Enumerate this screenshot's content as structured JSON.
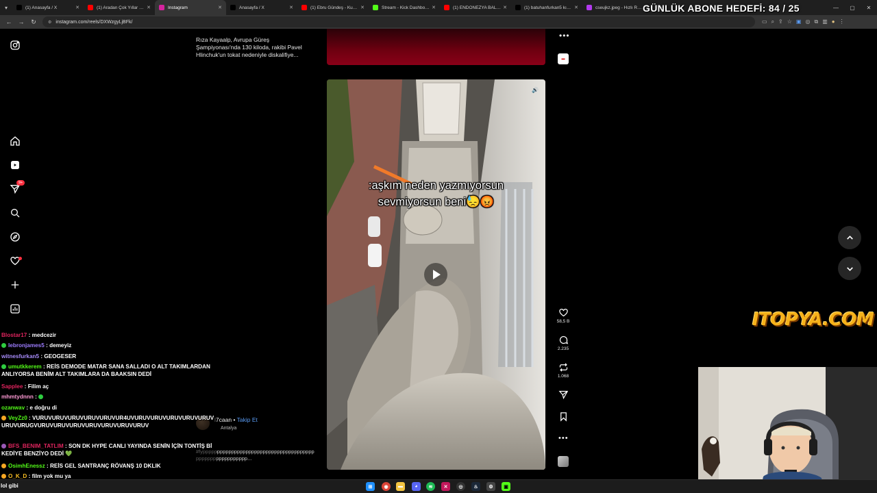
{
  "browser": {
    "tabs": [
      {
        "title": "(1) Anasayfa / X",
        "icon": "x-logo-icon",
        "color": "#000000"
      },
      {
        "title": "(1) Aradan Çok Yıllar Geçti",
        "icon": "youtube-icon",
        "color": "#ff0000"
      },
      {
        "title": "Instagram",
        "icon": "instagram-icon",
        "color": "#d6249f"
      },
      {
        "title": "Anasayfa / X",
        "icon": "x-logo-icon",
        "color": "#000000"
      },
      {
        "title": "(1) Ebru Gündeş - Kurşun",
        "icon": "youtube-icon",
        "color": "#ff0000"
      },
      {
        "title": "Stream - Kick Dashboard",
        "icon": "kick-icon",
        "color": "#53fc18"
      },
      {
        "title": "(1) ENDONEZYA BALI'DA",
        "icon": "youtube-icon",
        "color": "#ff0000"
      },
      {
        "title": "(1) batuhanfurkan5 kırıyor",
        "icon": "x-logo-icon",
        "color": "#000000"
      },
      {
        "title": "cseujkz.jpeg - Hızlı Resim",
        "icon": "image-icon",
        "color": "#b23aee"
      }
    ],
    "new_tab": "+",
    "url": "instagram.com/reels/DXWzgyLjBFk/"
  },
  "stream_goal": "GÜNLÜK ABONE HEDEFİ: 84 / 25",
  "instagram": {
    "sidebar_icons": [
      "instagram-logo-icon",
      "home-icon",
      "reels-icon",
      "messages-icon",
      "search-icon",
      "explore-icon",
      "notifications-icon",
      "create-icon",
      "dashboard-icon"
    ],
    "messages_badge": "9+",
    "previous_reel_caption": "Rıza Kayaalp, Avrupa Güreş Şampiyonası'nda 130 kiloda, rakibi Pavel Hlinchuk'un tokat nedeniyle diskalifiye...",
    "reel": {
      "overlay_line1": ":aşkım neden yazmıyorsun",
      "overlay_line2": "sevmiyorsun beni😓😡",
      "likes": "58,5 B",
      "comments": "2.235",
      "reposts": "1.068",
      "author": "l7caan",
      "follow": "Takip Et",
      "location": "Antalya",
      "caption": "#fyppppppppppppppppppppppppppppppppppppppppppppppppppppppppp..."
    }
  },
  "brand_overlay": "ITOPYA.COM",
  "chat": [
    {
      "user": "Blostar17",
      "msg": "medcezir",
      "color": "#e0245e"
    },
    {
      "user": "lebronjames5",
      "msg": "demeyiz",
      "color": "#9d7cff"
    },
    {
      "user": "witnesfurkan5",
      "msg": "GEOGESER",
      "color": "#a78bfa"
    },
    {
      "user": "umutkkerem",
      "msg": "REİS DEMODE MATAR SANA SALLADI O ALT TAKIMLARDAN ANLIYORSA BENİM ALT TAKIMLARA DA BAAKSIN DEDİ",
      "color": "#53fc18"
    },
    {
      "user": "Sapplee",
      "msg": "Filim aç",
      "color": "#e0245e"
    },
    {
      "user": "mhmtydnnn",
      "msg": "",
      "color": "#ff9ad5"
    },
    {
      "user": "ozanwav",
      "msg": "e doğru di",
      "color": "#53fc18"
    },
    {
      "user": "VeyZz0",
      "msg": "VURUVURUVURUVURUVURUVUR4UVURUVURUVURUVURUVURUVURUVURUGVURUVURUVURUVURUVURUVURUVURUV",
      "color": "#53fc18"
    },
    {
      "user": "BFS_BENIM_TATLIM",
      "msg": "SON DK HYPE CANLI YAYINDA SENİN İÇİN TONTİŞ Bİ KEDİYE BENZİYO DEDİ 💚",
      "color": "#e0245e"
    },
    {
      "user": "OsimhEnessz",
      "msg": "REİS GEL SANTRANÇ RÖVANŞ 10 DKLIK",
      "color": "#53fc18"
    },
    {
      "user": "O_K_D",
      "msg": "film yok mu ya",
      "color": "#fbbf24"
    }
  ],
  "taskbar_text": "lol gibi",
  "taskbar_icons": [
    "windows-icon",
    "chrome-icon",
    "file-explorer-icon",
    "discord-icon",
    "spotify-icon",
    "x-app-icon",
    "obs-icon",
    "steam-icon",
    "settings-icon",
    "kick-app-icon"
  ]
}
